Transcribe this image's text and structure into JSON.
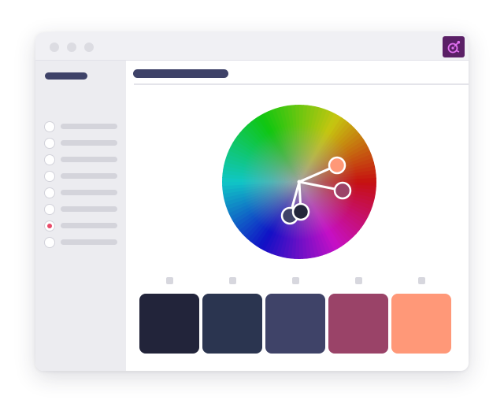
{
  "window": {
    "traffic_lights": [
      "close-dot",
      "minimize-dot",
      "maximize-dot"
    ],
    "app_icon": "color-palette-icon",
    "app_icon_color": "#5a1f66"
  },
  "sidebar": {
    "items": [
      {
        "state": "unselected"
      },
      {
        "state": "unselected"
      },
      {
        "state": "unselected"
      },
      {
        "state": "unselected"
      },
      {
        "state": "unselected"
      },
      {
        "state": "unselected"
      },
      {
        "state": "selected"
      },
      {
        "state": "unselected"
      }
    ],
    "accent_color": "#e84b6a"
  },
  "color_wheel": {
    "center_hub": "#2a2a3f",
    "handles": [
      {
        "role": "base",
        "color": "#ff9878"
      },
      {
        "role": "secondary",
        "color": "#9b4368"
      },
      {
        "role": "secondary",
        "color": "#3f4368"
      },
      {
        "role": "secondary",
        "color": "#22253a"
      }
    ]
  },
  "palette": {
    "swatches": [
      {
        "color": "#22243a"
      },
      {
        "color": "#2b3550"
      },
      {
        "color": "#3f4368"
      },
      {
        "color": "#9a4368"
      },
      {
        "color": "#ff9878"
      }
    ]
  }
}
